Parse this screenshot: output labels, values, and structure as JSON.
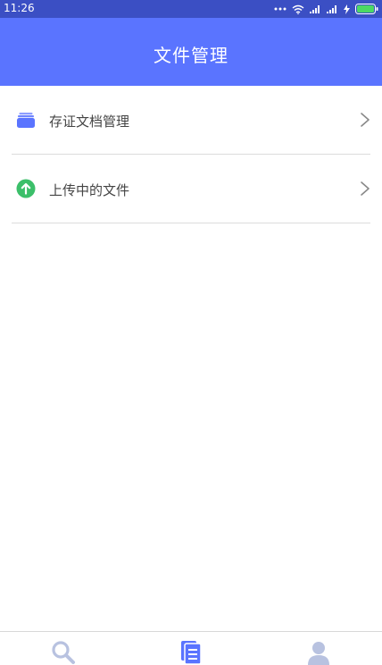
{
  "status_bar": {
    "time": "11:26"
  },
  "header": {
    "title": "文件管理"
  },
  "menu": {
    "items": [
      {
        "label": "存证文档管理",
        "icon": "folder-stack-icon",
        "icon_color": "#5a74ff"
      },
      {
        "label": "上传中的文件",
        "icon": "upload-arrow-icon",
        "icon_color": "#3cbf6a"
      }
    ]
  },
  "bottom_nav": {
    "tabs": [
      {
        "icon": "search-icon",
        "color": "#b8c2e0",
        "active": false
      },
      {
        "icon": "documents-icon",
        "color": "#5a74ff",
        "active": true
      },
      {
        "icon": "user-icon",
        "color": "#b8c2e0",
        "active": false
      }
    ]
  },
  "colors": {
    "header_bg": "#5a74ff",
    "status_bar_bg": "#3b4fc4",
    "battery_green": "#4cd964"
  }
}
